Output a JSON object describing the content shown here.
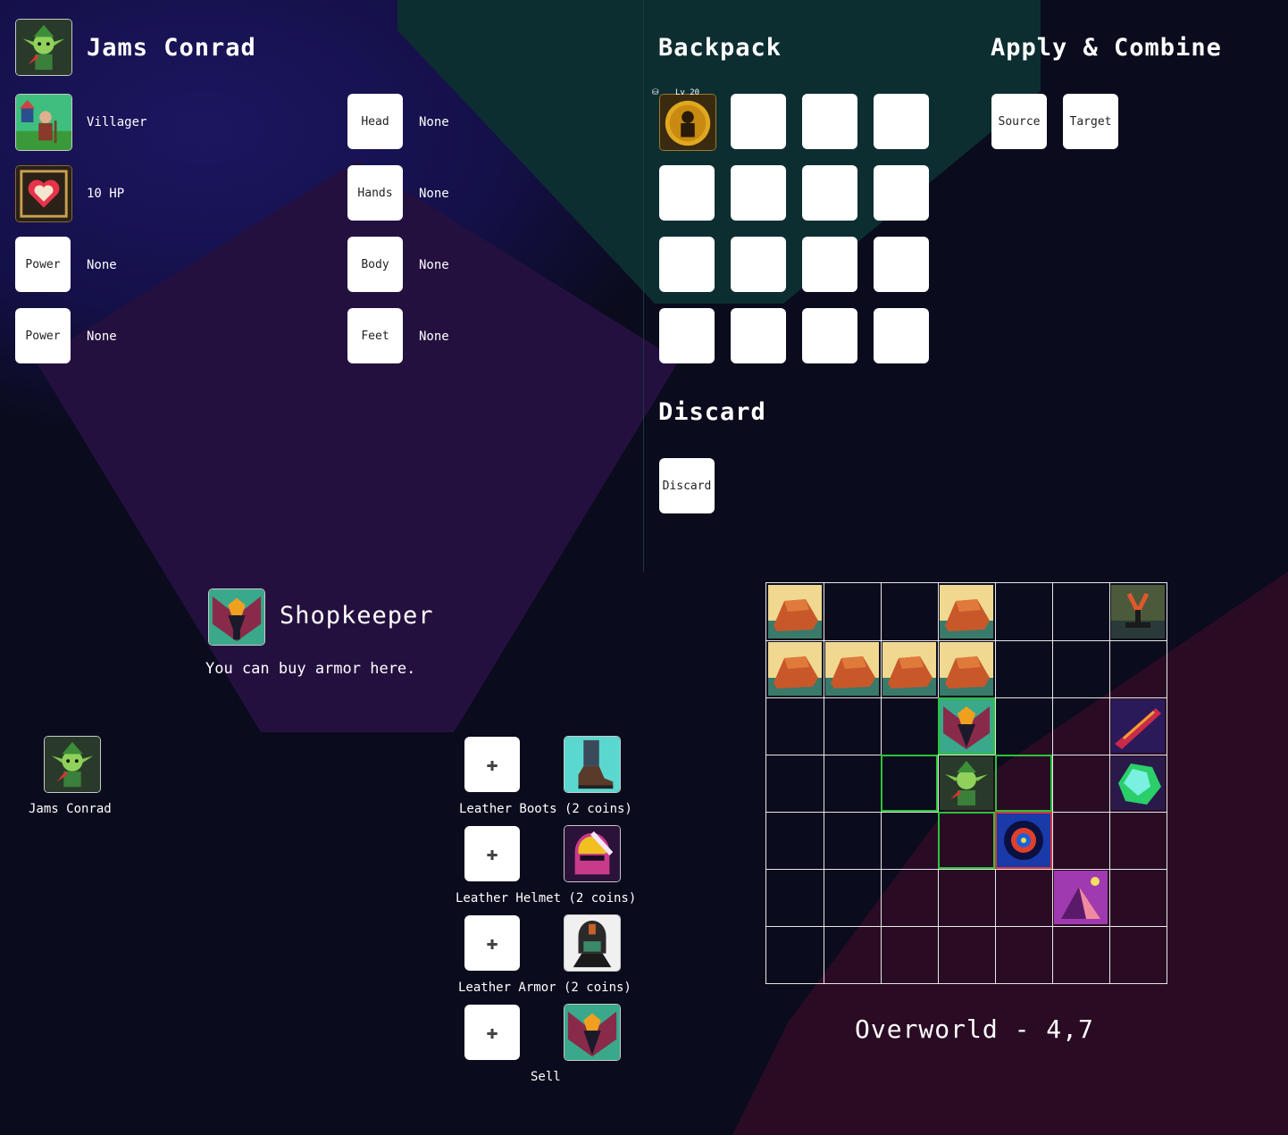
{
  "player": {
    "name": "Jams Conrad",
    "class_label": "Villager",
    "hp_label": "10 HP",
    "powers": [
      {
        "slot_label": "Power",
        "value": "None"
      },
      {
        "slot_label": "Power",
        "value": "None"
      }
    ]
  },
  "equipment": [
    {
      "slot_label": "Head",
      "value": "None"
    },
    {
      "slot_label": "Hands",
      "value": "None"
    },
    {
      "slot_label": "Body",
      "value": "None"
    },
    {
      "slot_label": "Feet",
      "value": "None"
    }
  ],
  "backpack": {
    "title": "Backpack",
    "first_item_badge": "Lv 20"
  },
  "apply_combine": {
    "title": "Apply & Combine",
    "source_label": "Source",
    "target_label": "Target"
  },
  "discard": {
    "title": "Discard",
    "button_label": "Discard"
  },
  "shop": {
    "keeper_name": "Shopkeeper",
    "message": "You can buy armor here.",
    "customer_name": "Jams Conrad",
    "plus_glyph": "✚",
    "items": [
      {
        "label": "Leather Boots (2 coins)",
        "icon": "boots-icon"
      },
      {
        "label": "Leather Helmet (2 coins)",
        "icon": "helmet-icon"
      },
      {
        "label": "Leather Armor (2 coins)",
        "icon": "armor-icon"
      },
      {
        "label": "Sell",
        "icon": "shopkeeper-icon"
      }
    ]
  },
  "map": {
    "location_label": "Overworld - 4,7",
    "cols": 7,
    "rows": 7,
    "cells": [
      [
        "rock",
        "",
        "",
        "rock",
        "",
        "",
        "tower"
      ],
      [
        "rock",
        "rock",
        "rock",
        "rock",
        "",
        "",
        ""
      ],
      [
        "",
        "",
        "",
        "shopkeeper",
        "",
        "",
        "sword"
      ],
      [
        "",
        "",
        "",
        "player",
        "",
        "",
        "crystal"
      ],
      [
        "",
        "",
        "",
        "",
        "portal",
        "",
        ""
      ],
      [
        "",
        "",
        "",
        "",
        "",
        "pyramid",
        ""
      ],
      [
        "",
        "",
        "",
        "",
        "",
        "",
        ""
      ]
    ],
    "highlighted_green": [
      [
        2,
        3
      ],
      [
        3,
        2
      ],
      [
        3,
        4
      ],
      [
        4,
        3
      ]
    ],
    "highlighted_red": [
      [
        4,
        4
      ]
    ]
  },
  "colors": {
    "accent_green": "#2cc33a",
    "accent_red": "#d43a3a"
  }
}
